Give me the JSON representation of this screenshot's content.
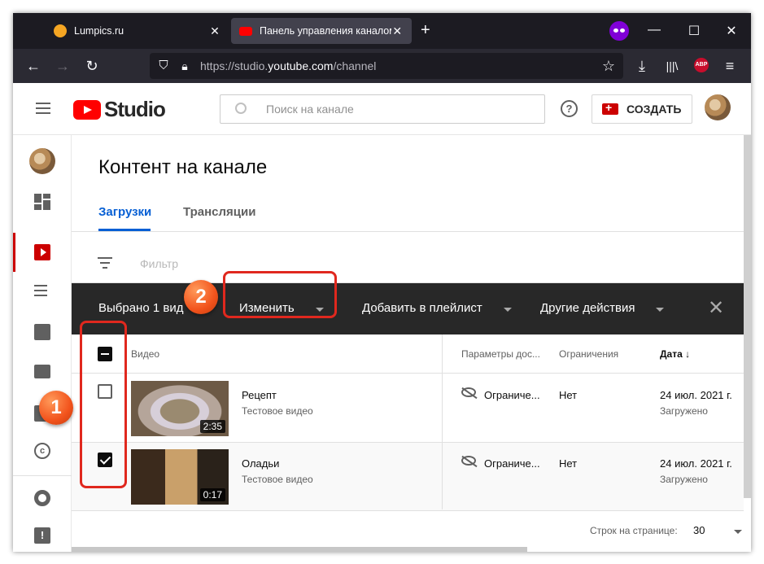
{
  "browser": {
    "tabs": [
      {
        "title": "Lumpics.ru",
        "active": false
      },
      {
        "title": "Панель управления каналом",
        "active": true
      }
    ],
    "url_prefix": "https://studio.",
    "url_domain": "youtube.com",
    "url_path": "/channel",
    "abp_label": "ABP"
  },
  "header": {
    "logo_text": "Studio",
    "search_placeholder": "Поиск на канале",
    "help_glyph": "?",
    "create_label": "СОЗДАТЬ"
  },
  "page": {
    "title": "Контент на канале",
    "tabs": [
      "Загрузки",
      "Трансляции"
    ],
    "filter_placeholder": "Фильтр"
  },
  "selection_bar": {
    "selected_text": "Выбрано 1 вид",
    "edit_label": "Изменить",
    "add_playlist_label": "Добавить в плейлист",
    "more_actions_label": "Другие действия",
    "close_glyph": "✕"
  },
  "table": {
    "headers": {
      "video": "Видео",
      "visibility": "Параметры дос...",
      "restrictions": "Ограничения",
      "date": "Дата"
    },
    "rows": [
      {
        "title": "Рецепт",
        "description": "Тестовое видео",
        "duration": "2:35",
        "visibility": "Ограниче...",
        "restrictions": "Нет",
        "date": "24 июл. 2021 г.",
        "status": "Загружено",
        "checked": false
      },
      {
        "title": "Оладьи",
        "description": "Тестовое видео",
        "duration": "0:17",
        "visibility": "Ограниче...",
        "restrictions": "Нет",
        "date": "24 июл. 2021 г.",
        "status": "Загружено",
        "checked": true
      }
    ]
  },
  "footer": {
    "rows_per_page_label": "Строк на странице:",
    "rows_per_page_value": "30"
  },
  "annotations": {
    "badge1": "1",
    "badge2": "2"
  },
  "colors": {
    "accent_red": "#ff0000",
    "annotation_red": "#e0281e",
    "link_blue": "#065fd4",
    "selection_bar": "#282828"
  }
}
